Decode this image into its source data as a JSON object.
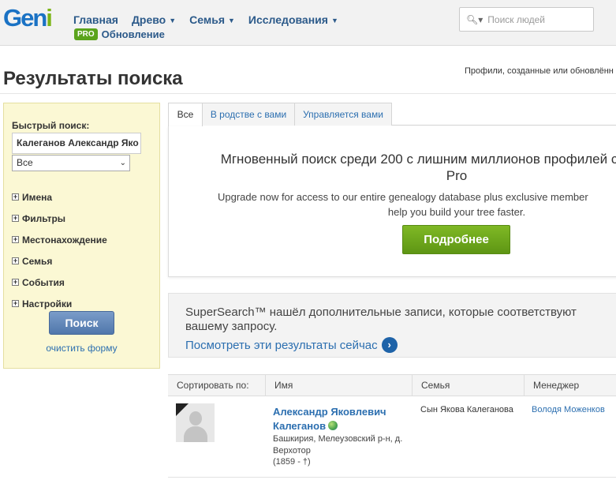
{
  "header": {
    "logo_main": "Gen",
    "logo_i": "i",
    "nav": [
      {
        "label": "Главная",
        "dropdown": false
      },
      {
        "label": "Древо",
        "dropdown": true
      },
      {
        "label": "Семья",
        "dropdown": true
      },
      {
        "label": "Исследования",
        "dropdown": true
      }
    ],
    "pro_badge": "PRO",
    "pro_link": "Обновление",
    "search_placeholder": "Поиск людей"
  },
  "page": {
    "title": "Результаты поиска",
    "top_right_note": "Профили, созданные или обновлённ"
  },
  "sidebar": {
    "quick_search_label": "Быстрый поиск:",
    "quick_search_value": "Калеганов Александр Яко",
    "scope_select": "Все",
    "filters": [
      "Имена",
      "Фильтры",
      "Местонахождение",
      "Семья",
      "События",
      "Настройки"
    ],
    "search_button": "Поиск",
    "clear_link": "очистить форму"
  },
  "tabs": [
    {
      "label": "Все",
      "active": true
    },
    {
      "label": "В родстве с вами",
      "active": false
    },
    {
      "label": "Управляется вами",
      "active": false
    }
  ],
  "upgrade": {
    "title_line1": "Мгновенный поиск среди 200 с лишним миллионов профилей с",
    "title_line2": "Pro",
    "subtitle_line1": "Upgrade now for access to our entire genealogy database plus exclusive member",
    "subtitle_line2": "help you build your tree faster.",
    "button": "Подробнее"
  },
  "supersearch": {
    "text": "SuperSearch™ нашёл дополнительные записи, которые соответствуют вашему запросу.",
    "link": "Посмотреть эти результаты сейчас",
    "arrow": "›"
  },
  "results": {
    "columns": [
      "Сортировать по:",
      "Имя",
      "Семья",
      "Менеджер"
    ],
    "rows": [
      {
        "name": "Александр Яковлевич Калеганов",
        "place": "Башкирия, Мелеузовский р-н, д. Верхотор",
        "dates": "(1859 - †)",
        "family": "Сын Якова Калеганова",
        "manager": "Володя Моженков"
      }
    ]
  },
  "colors": {
    "brand_blue": "#1a72c4",
    "brand_green": "#7cb518",
    "link": "#2c6fb0",
    "sidebar_bg": "#fbf8d4",
    "cta_green": "#6ea81e",
    "search_button": "#5a80b5"
  }
}
